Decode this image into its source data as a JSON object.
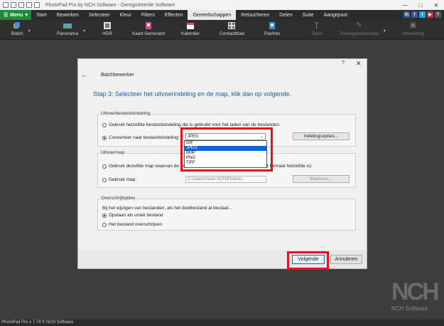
{
  "window": {
    "title": "PhotoPad Pro by NCH Software - Geregistreerde Software"
  },
  "menu": {
    "menu_label": "Menu",
    "tabs": [
      "Start",
      "Bewerken",
      "Selecteer",
      "Kleur",
      "Filters",
      "Effecten",
      "Gereedschappen",
      "Retoucheren",
      "Delen",
      "Suite",
      "Aangepast"
    ],
    "active_tab": "Gereedschappen"
  },
  "toolbar": {
    "batch": "Batch",
    "panorama": "Panorama",
    "hdr": "HDR",
    "kaart": "Kaart Generator",
    "kalender": "Kalender",
    "contactblad": "Contactblad",
    "pasfoto": "Pasfoto",
    "tekst": "Tekst",
    "tekengereedschap": "Tekengereedschap",
    "afbeelding": "Afbeelding"
  },
  "dialog": {
    "title": "Batchbewerker",
    "help": "?",
    "heading": "Stap 3: Selecteer het uitvoerindeling en de map, klik dan op volgende.",
    "output_format": {
      "label": "Uitvoerbestandsindeling",
      "option_same": "Gebruik hetzelfde bestandsindeling die is gebruikt voor het laden van de bestanden",
      "option_convert": "Converteer naar bestandsindeling:",
      "selected_format": "JPEG",
      "format_options": [
        "GIF",
        "JPEG",
        "BMP",
        "PNG",
        "TIFF"
      ],
      "settings_button": "Indelingsopties..."
    },
    "output_folder": {
      "label": "Uitvoermap",
      "option_same_prefix": "Gebruik dezelfde map waarvan de be",
      "option_same_suffix": "t formaat hetzelfde is)",
      "option_use": "Gebruik map:",
      "folder_path": "C:\\Users\\Yasin NCH\\Pictures",
      "browse_button": "Bladeren..."
    },
    "overwrite": {
      "label": "Overschrijfopties",
      "question": "Bij het wijzigen van bestanden, als het doelbestand al bestaat...",
      "option_unique": "Opslaan als uniek bestand",
      "option_overwrite": "Het bestand overschrijven"
    },
    "next_button": "Volgende",
    "cancel_button": "Annuleren"
  },
  "status": {
    "text": "PhotoPad Pro v 7.74 © NCH Software"
  },
  "logo": {
    "letters": "NCH",
    "sub": "NCH Software"
  },
  "colors": {
    "menu_green": "#1f8a3a",
    "highlight_red": "#e8101a",
    "selection_blue": "#0a68d0",
    "heading_blue": "#1a5fb4"
  }
}
